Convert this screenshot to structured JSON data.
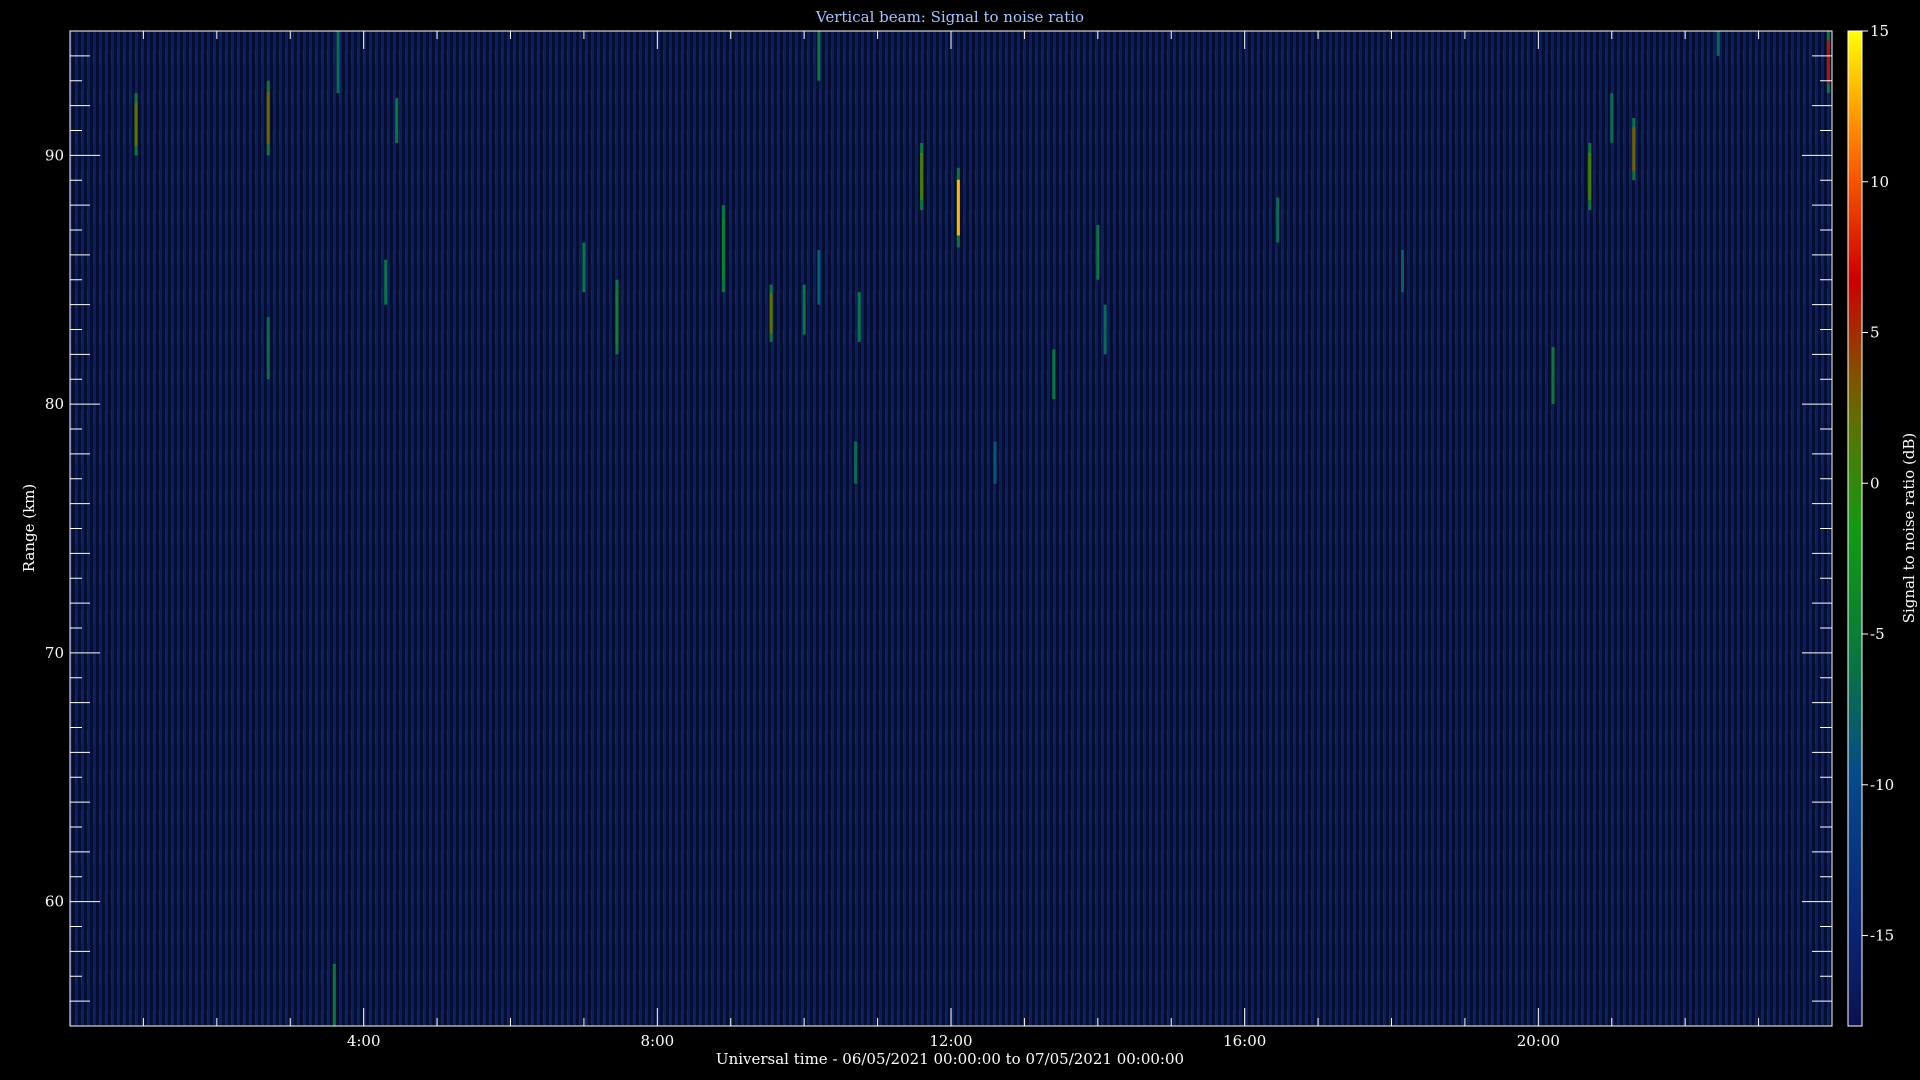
{
  "chart_data": {
    "type": "heatmap",
    "title": "Vertical beam: Signal to noise ratio",
    "xlabel": "Universal time - 06/05/2021 00:00:00 to 07/05/2021 00:00:00",
    "ylabel": "Range (km)",
    "colorbar_label": "Signal to noise ratio (dB)",
    "xlim": [
      0,
      24
    ],
    "ylim": [
      55,
      95
    ],
    "zlim": [
      -18,
      15
    ],
    "x_major_ticks": [
      4,
      8,
      12,
      16,
      20
    ],
    "x_tick_labels": [
      "4:00",
      "8:00",
      "12:00",
      "16:00",
      "20:00"
    ],
    "y_major_ticks": [
      60,
      70,
      80,
      90
    ],
    "y_tick_labels": [
      "60",
      "70",
      "80",
      "90"
    ],
    "colorbar_ticks": [
      -15,
      -10,
      -5,
      0,
      5,
      10,
      15
    ],
    "colorbar_tick_labels": [
      "-15",
      "-10",
      "-5",
      "0",
      "5",
      "10",
      "15"
    ],
    "background_snr": -16,
    "colormap": [
      "#0b1250",
      "#0a2a7a",
      "#064a8a",
      "#0a7a3a",
      "#129a12",
      "#6a6a00",
      "#cc0000",
      "#ff6a00",
      "#ffff00"
    ],
    "echoes": [
      {
        "t": 0.9,
        "r0": 90,
        "r1": 92.5,
        "snr": 2
      },
      {
        "t": 2.7,
        "r0": 90,
        "r1": 93,
        "snr": 3
      },
      {
        "t": 2.7,
        "r0": 81,
        "r1": 83.5,
        "snr": -7
      },
      {
        "t": 3.6,
        "r0": 55,
        "r1": 57.5,
        "snr": -6
      },
      {
        "t": 3.65,
        "r0": 92.5,
        "r1": 95,
        "snr": -7
      },
      {
        "t": 4.3,
        "r0": 84,
        "r1": 85.8,
        "snr": -6
      },
      {
        "t": 4.45,
        "r0": 90.5,
        "r1": 92.3,
        "snr": -6
      },
      {
        "t": 7.0,
        "r0": 84.5,
        "r1": 86.5,
        "snr": -6
      },
      {
        "t": 7.45,
        "r0": 82,
        "r1": 85,
        "snr": -5
      },
      {
        "t": 8.9,
        "r0": 84.5,
        "r1": 88,
        "snr": -5
      },
      {
        "t": 9.55,
        "r0": 82.5,
        "r1": 84.8,
        "snr": 2
      },
      {
        "t": 10.0,
        "r0": 82.8,
        "r1": 84.8,
        "snr": -6
      },
      {
        "t": 10.2,
        "r0": 93,
        "r1": 95,
        "snr": -6
      },
      {
        "t": 10.2,
        "r0": 84,
        "r1": 86.2,
        "snr": -8
      },
      {
        "t": 10.75,
        "r0": 82.5,
        "r1": 84.5,
        "snr": -6
      },
      {
        "t": 10.7,
        "r0": 76.8,
        "r1": 78.5,
        "snr": -7
      },
      {
        "t": 11.6,
        "r0": 87.8,
        "r1": 90.5,
        "snr": 1
      },
      {
        "t": 12.1,
        "r0": 86.3,
        "r1": 89.5,
        "snr": 13
      },
      {
        "t": 12.6,
        "r0": 76.8,
        "r1": 78.5,
        "snr": -9
      },
      {
        "t": 13.4,
        "r0": 80.2,
        "r1": 82.2,
        "snr": -6
      },
      {
        "t": 14.0,
        "r0": 85,
        "r1": 87.2,
        "snr": -6
      },
      {
        "t": 14.1,
        "r0": 82,
        "r1": 84,
        "snr": -7
      },
      {
        "t": 16.45,
        "r0": 86.5,
        "r1": 88.3,
        "snr": -7
      },
      {
        "t": 18.15,
        "r0": 84.5,
        "r1": 86.2,
        "snr": -8
      },
      {
        "t": 20.2,
        "r0": 80,
        "r1": 82.3,
        "snr": -6
      },
      {
        "t": 20.7,
        "r0": 87.8,
        "r1": 90.5,
        "snr": 1
      },
      {
        "t": 21.0,
        "r0": 90.5,
        "r1": 92.5,
        "snr": -7
      },
      {
        "t": 21.3,
        "r0": 89,
        "r1": 91.5,
        "snr": 3
      },
      {
        "t": 22.45,
        "r0": 94,
        "r1": 95,
        "snr": -7
      },
      {
        "t": 23.95,
        "r0": 92.5,
        "r1": 95,
        "snr": 6
      }
    ]
  }
}
